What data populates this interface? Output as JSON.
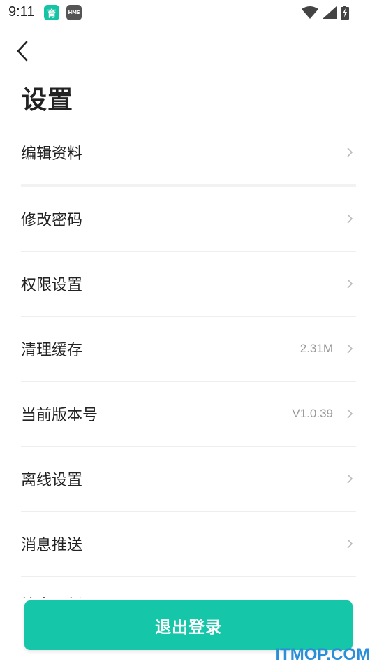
{
  "status_bar": {
    "time": "9:11",
    "app_badge_1": "育",
    "app_badge_2": "HMS"
  },
  "header": {
    "title": "设置"
  },
  "settings": {
    "items": [
      {
        "label": "编辑资料",
        "value": ""
      },
      {
        "label": "修改密码",
        "value": ""
      },
      {
        "label": "权限设置",
        "value": ""
      },
      {
        "label": "清理缓存",
        "value": "2.31M"
      },
      {
        "label": "当前版本号",
        "value": "V1.0.39"
      },
      {
        "label": "离线设置",
        "value": ""
      },
      {
        "label": "消息推送",
        "value": ""
      }
    ],
    "partial_item": "检查更新"
  },
  "footer": {
    "logout_label": "退出登录"
  },
  "watermark": "ITMOP.COM",
  "colors": {
    "accent": "#16c6a9",
    "watermark": "#2a8fd8"
  }
}
